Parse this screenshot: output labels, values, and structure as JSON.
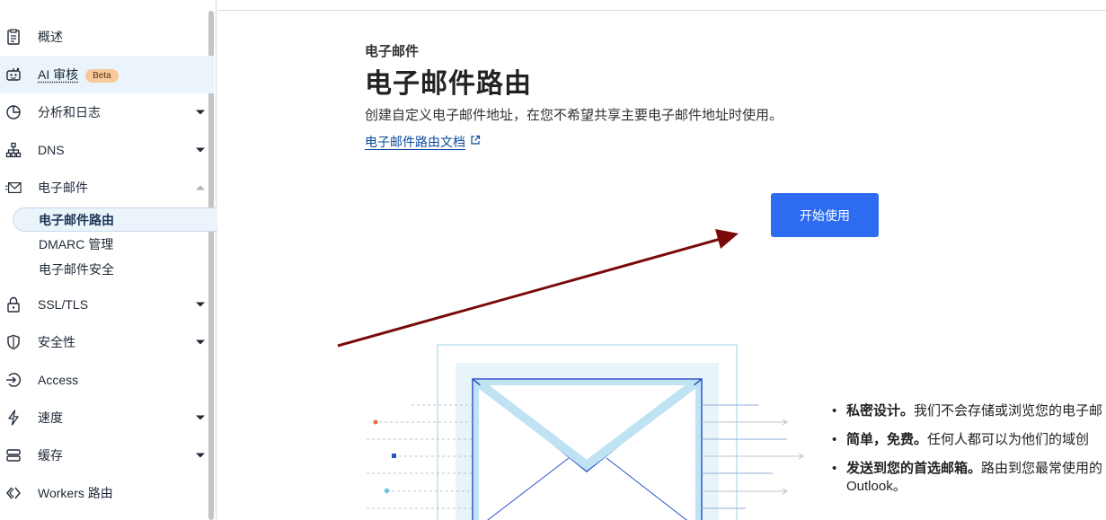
{
  "sidebar": {
    "items": [
      {
        "label": "概述",
        "icon": "clipboard-icon"
      },
      {
        "label": "AI 审核",
        "badge": "Beta",
        "icon": "robot-icon"
      },
      {
        "label": "分析和日志",
        "icon": "pie-chart-icon"
      },
      {
        "label": "DNS",
        "icon": "network-icon"
      },
      {
        "label": "电子邮件",
        "icon": "envelope-icon"
      },
      {
        "label": "SSL/TLS",
        "icon": "lock-icon"
      },
      {
        "label": "安全性",
        "icon": "shield-icon"
      },
      {
        "label": "Access",
        "icon": "access-icon"
      },
      {
        "label": "速度",
        "icon": "lightning-icon"
      },
      {
        "label": "缓存",
        "icon": "storage-icon"
      },
      {
        "label": "Workers 路由",
        "icon": "workers-icon"
      }
    ],
    "email_sub": [
      "电子邮件路由",
      "DMARC 管理",
      "电子邮件安全"
    ]
  },
  "main": {
    "eyebrow": "电子邮件",
    "title": "电子邮件路由",
    "description": "创建自定义电子邮件地址，在您不希望共享主要电子邮件地址时使用。",
    "doc_link": "电子邮件路由文档",
    "start_button": "开始使用"
  },
  "features": [
    {
      "bold": "私密设计。",
      "text": "我们不会存储或浏览您的电子邮"
    },
    {
      "bold": "简单，免费。",
      "text": "任何人都可以为他们的域创"
    },
    {
      "bold": "发送到您的首选邮箱。",
      "text": "路由到您最常使用的",
      "cont": "Outlook。"
    }
  ],
  "colors": {
    "accent": "#2d6cf1",
    "link": "#0a4a9e",
    "active_bg": "#eaf4fa",
    "annotation_arrow": "#7a0a0a"
  }
}
